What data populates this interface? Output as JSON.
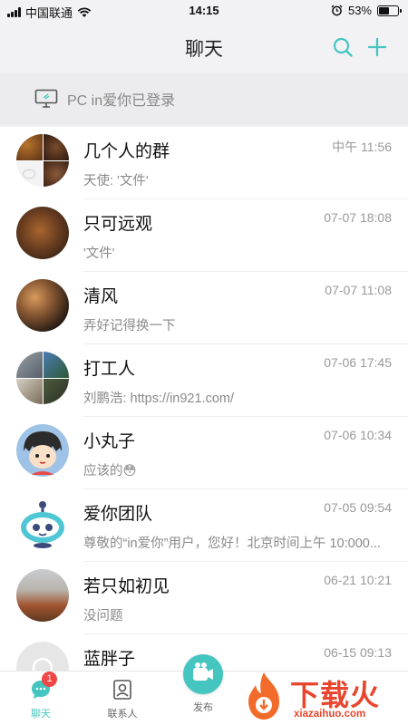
{
  "status_bar": {
    "carrier": "中国联通",
    "time": "14:15",
    "battery": "53%",
    "battery_level": 0.53,
    "icons": [
      "signal-icon",
      "wifi-icon",
      "alarm-icon",
      "battery-icon"
    ]
  },
  "header": {
    "title": "聊天",
    "accent_color": "#45c5c0",
    "icons": [
      "search-icon",
      "plus-icon"
    ]
  },
  "pc_banner": {
    "text": "PC in爱你已登录",
    "icon": "monitor-icon"
  },
  "chats": [
    {
      "name": "几个人的群",
      "time": "中午 11:56",
      "preview": "天使: '文件'"
    },
    {
      "name": "只可远观",
      "time": "07-07 18:08",
      "preview": "'文件'"
    },
    {
      "name": "清风",
      "time": "07-07 11:08",
      "preview": "弄好记得换一下"
    },
    {
      "name": "打工人",
      "time": "07-06 17:45",
      "preview": "刘鹏浩: https://in921.com/"
    },
    {
      "name": "小丸子",
      "time": "07-06 10:34",
      "preview": "应该的😳"
    },
    {
      "name": "爱你团队",
      "time": "07-05 09:54",
      "preview": "尊敬的“in爱你”用户，您好！北京时间上午 10:000..."
    },
    {
      "name": "若只如初见",
      "time": "06-21 10:21",
      "preview": "没问题"
    },
    {
      "name": "蓝胖子",
      "time": "06-15 09:13",
      "preview": ""
    }
  ],
  "tabs": [
    {
      "label": "聊天",
      "badge": "1",
      "icon": "chat-bubble-icon"
    },
    {
      "label": "联系人",
      "icon": "contacts-icon"
    },
    {
      "label": "发布",
      "icon": "video-camera-icon"
    }
  ],
  "watermark": {
    "text_cn": "下载火",
    "text_en": "xiazaihuo.com"
  }
}
